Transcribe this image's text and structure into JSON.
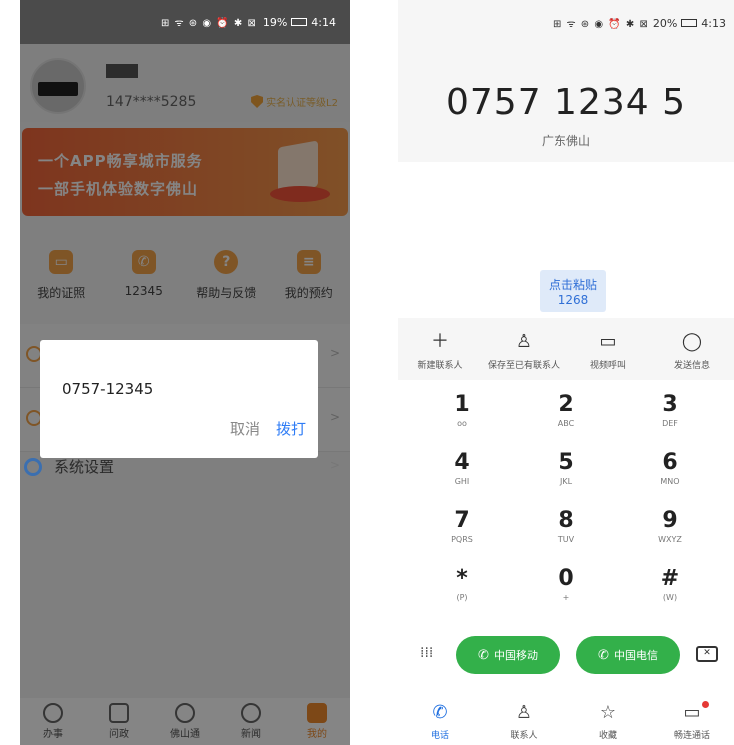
{
  "left": {
    "status": {
      "icons": "⊞ ᯤ ⊛ ◉ ⏰ ✱ ⊠",
      "battery": "19%",
      "time": "4:14"
    },
    "profile": {
      "phone": "147****5285",
      "verify_label": "实名认证等级L2"
    },
    "banner": {
      "line1": "一个APP畅享城市服务",
      "line2": "一部手机体验数字佛山"
    },
    "quick_items": [
      {
        "label": "我的证照",
        "icon": "id-card-icon"
      },
      {
        "label": "12345",
        "icon": "phone-icon"
      },
      {
        "label": "帮助与反馈",
        "icon": "question-icon"
      },
      {
        "label": "我的预约",
        "icon": "calendar-icon"
      }
    ],
    "settings_label": "系统设置",
    "dialog": {
      "number": "0757-12345",
      "cancel": "取消",
      "call": "拨打"
    },
    "tabs": [
      {
        "label": "办事",
        "icon": "compass-icon"
      },
      {
        "label": "问政",
        "icon": "message-icon"
      },
      {
        "label": "佛山通",
        "icon": "diamond-icon"
      },
      {
        "label": "新闻",
        "icon": "news-icon"
      },
      {
        "label": "我的",
        "icon": "profile-icon",
        "active": true
      }
    ],
    "accent": "#f08b2c"
  },
  "right": {
    "status": {
      "icons": "⊞ ᯤ ⊛ ◉ ⏰ ✱ ⊠",
      "battery": "20%",
      "time": "4:13"
    },
    "number": "0757 1234 5",
    "location": "广东佛山",
    "paste": {
      "line1": "点击粘贴",
      "line2": "1268"
    },
    "actions": [
      {
        "label": "新建联系人",
        "icon": "plus-icon"
      },
      {
        "label": "保存至已有联系人",
        "icon": "person-icon"
      },
      {
        "label": "视频呼叫",
        "icon": "video-icon"
      },
      {
        "label": "发送信息",
        "icon": "message-icon"
      }
    ],
    "keys": [
      [
        {
          "d": "1",
          "l": "ᴏᴏ"
        },
        {
          "d": "2",
          "l": "ABC"
        },
        {
          "d": "3",
          "l": "DEF"
        }
      ],
      [
        {
          "d": "4",
          "l": "GHI"
        },
        {
          "d": "5",
          "l": "JKL"
        },
        {
          "d": "6",
          "l": "MNO"
        }
      ],
      [
        {
          "d": "7",
          "l": "PQRS"
        },
        {
          "d": "8",
          "l": "TUV"
        },
        {
          "d": "9",
          "l": "WXYZ"
        }
      ],
      [
        {
          "d": "*",
          "l": "(P)"
        },
        {
          "d": "0",
          "l": "+"
        },
        {
          "d": "#",
          "l": "(W)"
        }
      ]
    ],
    "carriers": [
      {
        "label": "中国移动"
      },
      {
        "label": "中国电信"
      }
    ],
    "tabs": [
      {
        "label": "电话",
        "icon": "phone-icon",
        "active": true
      },
      {
        "label": "联系人",
        "icon": "contacts-icon"
      },
      {
        "label": "收藏",
        "icon": "star-icon"
      },
      {
        "label": "畅连通话",
        "icon": "chat-icon"
      }
    ],
    "accent": "#1f6fe0",
    "call_green": "#33b04a"
  }
}
